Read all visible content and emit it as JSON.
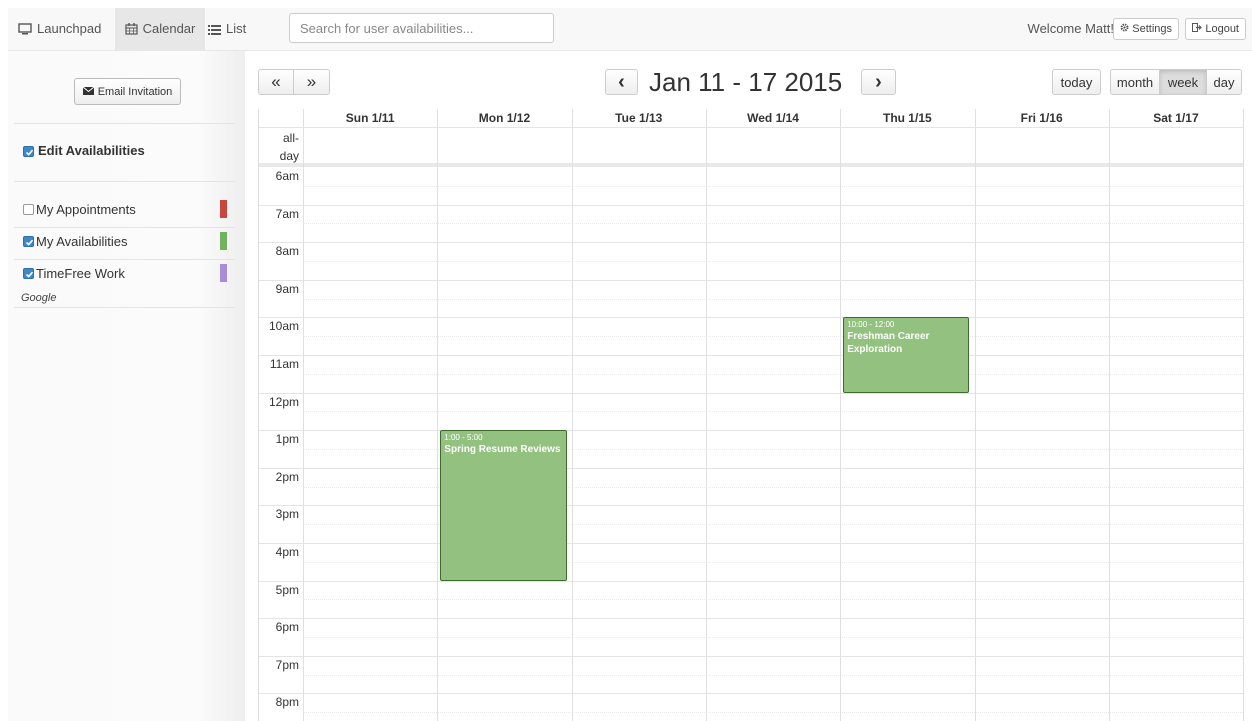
{
  "nav": {
    "launchpad": "Launchpad",
    "calendar": "Calendar",
    "list": "List",
    "search_placeholder": "Search for user availabilities...",
    "welcome": "Welcome Matt!",
    "settings": "Settings",
    "logout": "Logout"
  },
  "sidebar": {
    "email_invitation": "Email Invitation",
    "edit_availabilities": "Edit Availabilities",
    "calendars": [
      {
        "label": "My Appointments",
        "checked": false,
        "color": "#c9453d"
      },
      {
        "label": "My Availabilities",
        "checked": true,
        "color": "#6fb35f"
      },
      {
        "label": "TimeFree Work",
        "checked": true,
        "color": "#a78cd6"
      }
    ],
    "google_label": "Google"
  },
  "toolbar": {
    "prev_range": "«",
    "next_range": "»",
    "prev": "‹",
    "next": "›",
    "title": "Jan 11 - 17 2015",
    "today": "today",
    "views": [
      "month",
      "week",
      "day"
    ],
    "active_view": "week"
  },
  "calendar": {
    "days": [
      "Sun 1/11",
      "Mon 1/12",
      "Tue 1/13",
      "Wed 1/14",
      "Thu 1/15",
      "Fri 1/16",
      "Sat 1/17"
    ],
    "allday_label_1": "all-",
    "allday_label_2": "day",
    "times": [
      "6am",
      "7am",
      "8am",
      "9am",
      "10am",
      "11am",
      "12pm",
      "1pm",
      "2pm",
      "3pm",
      "4pm",
      "5pm",
      "6pm",
      "7pm",
      "8pm"
    ],
    "events": [
      {
        "day": 1,
        "start": 13,
        "end": 17,
        "time": "1:00 - 5:00",
        "title": "Spring Resume Reviews",
        "color": "#93c17f"
      },
      {
        "day": 4,
        "start": 10,
        "end": 12,
        "time": "10:00 - 12:00",
        "title": "Freshman Career Exploration",
        "color": "#93c17f"
      }
    ]
  }
}
